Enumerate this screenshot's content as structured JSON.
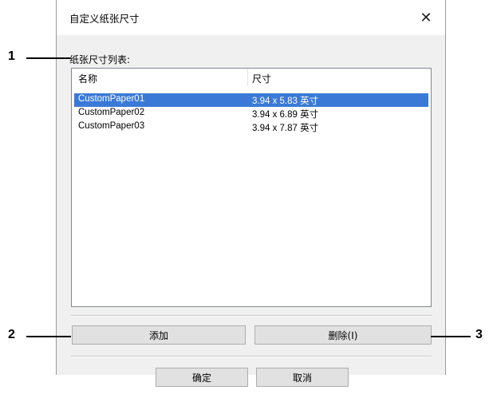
{
  "dialog": {
    "title": "自定义纸张尺寸",
    "close_icon": "close-icon",
    "list_label": "纸张尺寸列表:",
    "columns": [
      "名称",
      "尺寸"
    ],
    "rows": [
      {
        "name": "CustomPaper01",
        "size": "3.94 x 5.83 英寸",
        "selected": true
      },
      {
        "name": "CustomPaper02",
        "size": "3.94 x 6.89 英寸",
        "selected": false
      },
      {
        "name": "CustomPaper03",
        "size": "3.94 x 7.87 英寸",
        "selected": false
      }
    ],
    "add_label": "添加",
    "delete_label": "删除(I)",
    "ok_label": "确定",
    "cancel_label": "取消"
  },
  "callouts": {
    "c1": "1",
    "c2": "2",
    "c3": "3"
  },
  "colors": {
    "selection": "#3a7ad6",
    "dialog_bg": "#f0f0f0"
  }
}
